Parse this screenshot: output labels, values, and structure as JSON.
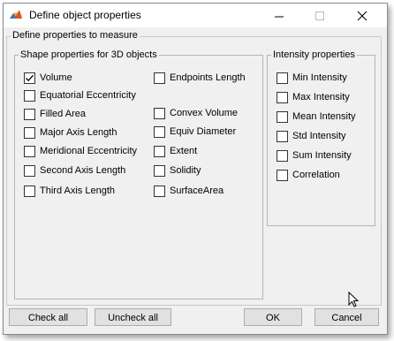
{
  "window": {
    "title": "Define object properties"
  },
  "groups": {
    "outer_title": "Define properties to measure",
    "shape_title": "Shape properties for 3D objects",
    "intensity_title": "Intensity properties"
  },
  "shape_col1": [
    {
      "label": "Volume",
      "checked": true
    },
    {
      "label": "Equatorial Eccentricity",
      "checked": false
    },
    {
      "label": "Filled Area",
      "checked": false
    },
    {
      "label": "Major Axis Length",
      "checked": false
    },
    {
      "label": "Meridional Eccentricity",
      "checked": false
    },
    {
      "label": "Second Axis Length",
      "checked": false
    },
    {
      "label": "Third Axis Length",
      "checked": false
    }
  ],
  "shape_col2": [
    {
      "label": "Endpoints Length",
      "checked": false
    },
    {
      "label": "Convex Volume",
      "checked": false
    },
    {
      "label": "Equiv Diameter",
      "checked": false
    },
    {
      "label": "Extent",
      "checked": false
    },
    {
      "label": "Solidity",
      "checked": false
    },
    {
      "label": "SurfaceArea",
      "checked": false
    }
  ],
  "intensity": [
    {
      "label": "Min Intensity",
      "checked": false
    },
    {
      "label": "Max Intensity",
      "checked": false
    },
    {
      "label": "Mean Intensity",
      "checked": false
    },
    {
      "label": "Std Intensity",
      "checked": false
    },
    {
      "label": "Sum Intensity",
      "checked": false
    },
    {
      "label": "Correlation",
      "checked": false
    }
  ],
  "buttons": {
    "check_all": "Check all",
    "uncheck_all": "Uncheck all",
    "ok": "OK",
    "cancel": "Cancel"
  }
}
